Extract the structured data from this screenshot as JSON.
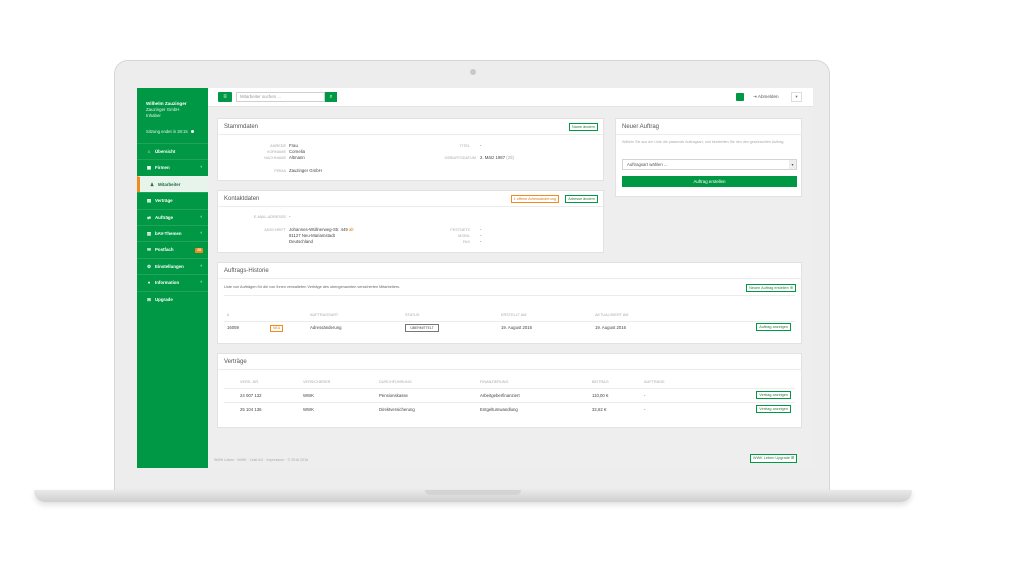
{
  "sidebar": {
    "user_name": "Wilhelm Zauzinger",
    "company": "Zauzinger GmbH",
    "role": "Inhaber",
    "session": "Sitzung endet in 28:15",
    "items": [
      {
        "label": "Übersicht",
        "icon": "home-icon"
      },
      {
        "label": "Firmen",
        "icon": "building-icon"
      },
      {
        "label": "Mitarbeiter",
        "icon": "users-icon"
      },
      {
        "label": "Verträge",
        "icon": "document-icon"
      },
      {
        "label": "Aufträge",
        "icon": "transfer-icon"
      },
      {
        "label": "bAV-Themen",
        "icon": "book-icon"
      },
      {
        "label": "Postfach",
        "icon": "mail-icon",
        "badge": "28"
      },
      {
        "label": "Einstellungen",
        "icon": "settings-icon"
      },
      {
        "label": "Information",
        "icon": "info-icon"
      },
      {
        "label": "Upgrade",
        "icon": "upgrade-icon"
      }
    ]
  },
  "topbar": {
    "search_placeholder": "Mitarbeiter suchen ...",
    "logout": "Abmelden"
  },
  "stammdaten": {
    "title": "Stammdaten",
    "edit": "Name ändern",
    "anrede_label": "ANREDE",
    "anrede": "Frau",
    "vorname_label": "VORNAME",
    "vorname": "Cornelia",
    "nachname_label": "NACHNAME",
    "nachname": "Altmann",
    "firma_label": "FIRMA",
    "firma": "Zauzinger GmbH",
    "titel_label": "TITEL",
    "titel": "-",
    "geburtsdatum_label": "GEBURTSDATUM",
    "geburtsdatum": "2. März 1987",
    "geburtsdatum_age": "(29)"
  },
  "kontaktdaten": {
    "title": "Kontaktdaten",
    "pending": "1 offene Adressänderung",
    "edit": "Adresse ändern",
    "email_label": "E-MAIL-ADRESSE",
    "email": "-",
    "anschrift_label": "ANSCHRIFT",
    "street": "Johannes-Wüllnerweg-Str. 449",
    "street_note": "alt",
    "city": "81127 Neu-Mariamstadt",
    "country": "Deutschland",
    "festnetz_label": "FESTNETZ",
    "festnetz": "-",
    "mobil_label": "MOBIL",
    "mobil": "-",
    "fax_label": "FAX",
    "fax": "-"
  },
  "neuer_auftrag": {
    "title": "Neuer Auftrag",
    "desc": "Wählen Sie aus der Liste die passende Auftragsart, und bearbeiten Sie den den gewünschten Auftrag.",
    "select": "Auftragsart wählen ...",
    "button": "Auftrag erstellen"
  },
  "historie": {
    "title": "Auftrags-Historie",
    "desc": "Liste von Aufträgen für die von Ihnen verwalteten Verträge des obengenannten versicherten Mitarbeiters.",
    "new_button": "Neuen Auftrag erstellen",
    "headers": [
      "#",
      "AUFTRAGSART",
      "STATUS",
      "ERSTELLT AM",
      "AKTUALISIERT AM"
    ],
    "rows": [
      {
        "id": "16059",
        "tag": "NEU",
        "type": "Adressänderung",
        "status": "ÜBERMITTELT",
        "created": "19. August 2016",
        "updated": "19. August 2016",
        "action": "Auftrag anzeigen"
      }
    ]
  },
  "vertraege": {
    "title": "Verträge",
    "headers": [
      "VERS.-NR.",
      "VERSICHERER",
      "DURCHFÜHRUNG",
      "FINANZIERUNG",
      "BEITRAG",
      "AUFTRÄGE"
    ],
    "rows": [
      {
        "nr": "24 007 132",
        "versicherer": "WWK",
        "durchfuehrung": "Pensionskasse",
        "finanzierung": "Arbeitgeberfinanziert",
        "beitrag": "110,00 €",
        "auftraege": "-",
        "action": "Vertrag anzeigen"
      },
      {
        "nr": "25 104 136",
        "versicherer": "WWK",
        "durchfuehrung": "Direktversicherung",
        "finanzierung": "Entgeltumwandlung",
        "beitrag": "32,62 €",
        "auftraege": "-",
        "action": "Vertrag anzeigen"
      }
    ]
  },
  "footer": {
    "text": "WWK Leben · WWK · Leist AG · Impressum · © 2016 2016",
    "button": "WWK Leben Upgrade"
  },
  "colors": {
    "brand": "#009844",
    "accent": "#f28a1e"
  }
}
